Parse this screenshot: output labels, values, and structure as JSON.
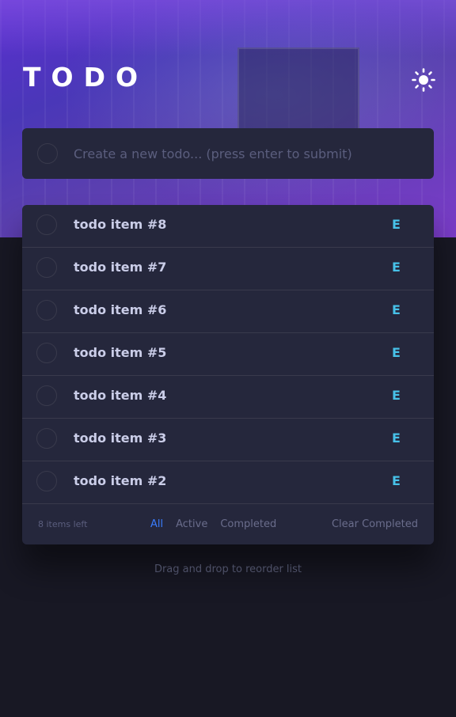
{
  "app": {
    "title": "TODO",
    "theme_icon": "sun-icon",
    "colors": {
      "background": "#181824",
      "card": "#25273c",
      "accent": "#3a7cfd",
      "edit": "#47c1e8"
    }
  },
  "new_todo": {
    "placeholder": "Create a new todo... (press enter to submit)",
    "value": ""
  },
  "todos": [
    {
      "label": "todo item #8",
      "edit_label": "E"
    },
    {
      "label": "todo item #7",
      "edit_label": "E"
    },
    {
      "label": "todo item #6",
      "edit_label": "E"
    },
    {
      "label": "todo item #5",
      "edit_label": "E"
    },
    {
      "label": "todo item #4",
      "edit_label": "E"
    },
    {
      "label": "todo item #3",
      "edit_label": "E"
    },
    {
      "label": "todo item #2",
      "edit_label": "E"
    }
  ],
  "footer": {
    "items_left": "8 items left",
    "filters": [
      "All",
      "Active",
      "Completed"
    ],
    "active_filter": "All",
    "clear_label": "Clear Completed"
  },
  "hint": "Drag and drop to reorder list"
}
